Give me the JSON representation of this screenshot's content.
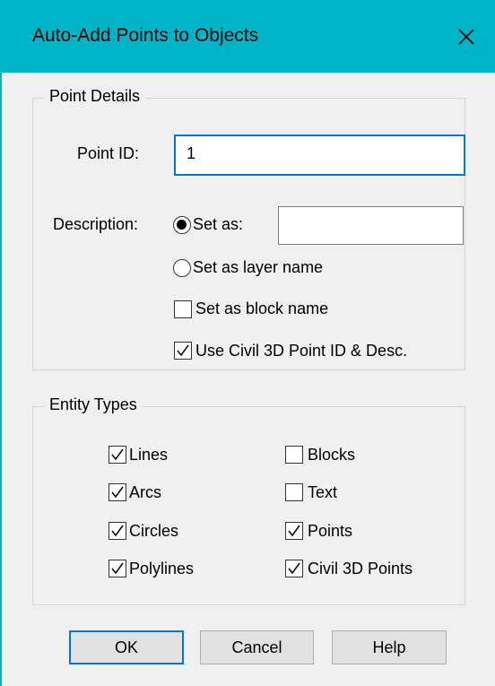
{
  "window": {
    "title": "Auto-Add Points to Objects",
    "accent": "#00b4c8"
  },
  "point_details": {
    "legend": "Point Details",
    "point_id_label": "Point ID:",
    "point_id_value": "1",
    "description_label": "Description:",
    "set_as_label": "Set as:",
    "set_as_value": "",
    "set_as_layer_label": "Set as layer name",
    "set_as_block_label": "Set as block name",
    "use_civil_label": "Use Civil 3D Point ID & Desc."
  },
  "entity_types": {
    "legend": "Entity Types",
    "items": [
      {
        "label": "Lines",
        "checked": true
      },
      {
        "label": "Arcs",
        "checked": true
      },
      {
        "label": "Circles",
        "checked": true
      },
      {
        "label": "Polylines",
        "checked": true
      },
      {
        "label": "Blocks",
        "checked": false
      },
      {
        "label": "Text",
        "checked": false
      },
      {
        "label": "Points",
        "checked": true
      },
      {
        "label": "Civil 3D Points",
        "checked": true
      }
    ]
  },
  "buttons": {
    "ok": "OK",
    "cancel": "Cancel",
    "help": "Help"
  }
}
